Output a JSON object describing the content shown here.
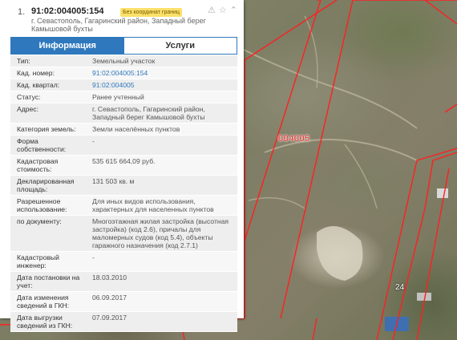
{
  "header": {
    "index": "1.",
    "cad_number": "91:02:004005:154",
    "badge": "Без координат границ",
    "address": "г. Севастополь, Гагаринский район, Западный берег Камышовой бухты",
    "icons": [
      "warning-icon",
      "star-icon",
      "collapse-icon"
    ]
  },
  "tabs": [
    {
      "label": "Информация"
    },
    {
      "label": "Услуги"
    }
  ],
  "rows": [
    {
      "label": "Тип:",
      "value": "Земельный участок"
    },
    {
      "label": "Кад. номер:",
      "value": "91:02:004005:154"
    },
    {
      "label": "Кад. квартал:",
      "value": "91:02:004005"
    },
    {
      "label": "Статус:",
      "value": "Ранее учтенный"
    },
    {
      "label": "Адрес:",
      "value": "г. Севастополь, Гагаринский район, Западный берег Камышовой бухты"
    },
    {
      "label": "Категория земель:",
      "value": "Земли населённых пунктов"
    },
    {
      "label": "Форма собственности:",
      "value": "-"
    },
    {
      "label": "Кадастровая стоимость:",
      "value": "535 615 664,09 руб."
    },
    {
      "label": "Декларированная площадь:",
      "value": "131 503 кв. м"
    },
    {
      "label": "Разрешенное использование:",
      "value": "Для иных видов использования, характерных для населенных пунктов"
    },
    {
      "label": "по документу:",
      "value": "Многоэтажная жилая застройка (высотная застройка) (код 2.6), причалы для маломерных судов (код 5.4), объекты гаражного назначения (код 2.7.1)"
    },
    {
      "label": "Кадастровый инженер:",
      "value": "-"
    },
    {
      "label": "Дата постановки на учет:",
      "value": "18.03.2010"
    },
    {
      "label": "Дата изменения сведений в ГКН:",
      "value": "06.09.2017"
    },
    {
      "label": "Дата выгрузки сведений из ГКН:",
      "value": "07.09.2017"
    }
  ],
  "map": {
    "quarter_label": "004005",
    "parcel_number": "24",
    "boundary_color": "#ff2020"
  }
}
